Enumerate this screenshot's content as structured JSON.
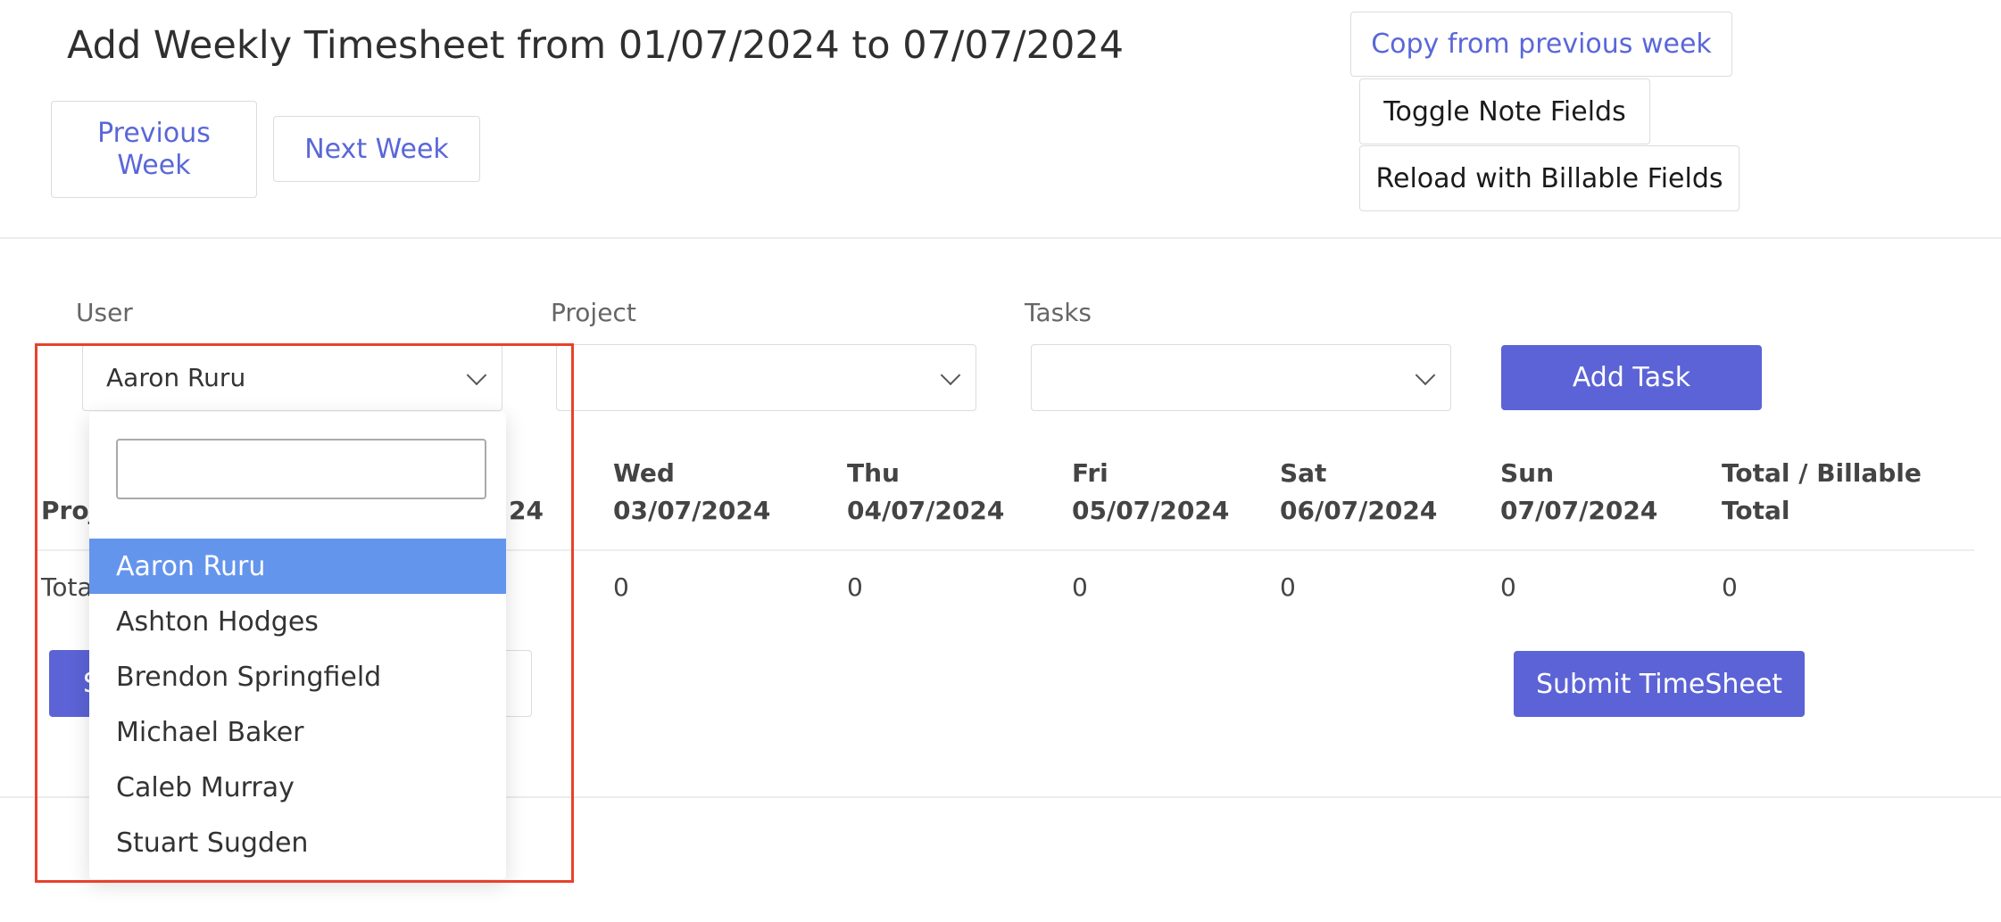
{
  "header": {
    "title": "Add Weekly Timesheet from 01/07/2024 to 07/07/2024",
    "previous_week": "Previous Week",
    "next_week": "Next Week",
    "copy_previous": "Copy from previous week",
    "toggle_notes": "Toggle Note Fields",
    "reload_billable": "Reload with Billable Fields"
  },
  "filters": {
    "user_label": "User",
    "user_value": "Aaron Ruru",
    "project_label": "Project",
    "project_value": "",
    "tasks_label": "Tasks",
    "tasks_value": "",
    "add_task": "Add Task"
  },
  "table": {
    "project_header_partial": "Proj",
    "tue_date_partial": "24",
    "columns": [
      {
        "day": "Wed",
        "date": "03/07/2024"
      },
      {
        "day": "Thu",
        "date": "04/07/2024"
      },
      {
        "day": "Fri",
        "date": "05/07/2024"
      },
      {
        "day": "Sat",
        "date": "06/07/2024"
      },
      {
        "day": "Sun",
        "date": "07/07/2024"
      },
      {
        "day": "Total / Billable",
        "date": "Total"
      }
    ],
    "total_label_partial": "Tota",
    "totals": [
      "0",
      "0",
      "0",
      "0",
      "0",
      "0"
    ]
  },
  "actions": {
    "submit_timesheet": "Submit TimeSheet",
    "save_partial": "S"
  },
  "user_dropdown": {
    "search_value": "",
    "options": [
      "Aaron Ruru",
      "Ashton Hodges",
      "Brendon Springfield",
      "Michael Baker",
      "Caleb Murray",
      "Stuart Sugden"
    ],
    "selected": "Aaron Ruru"
  },
  "colors": {
    "primary": "#5b63d6",
    "link": "#5a67d8",
    "selected_option": "#6495ed",
    "highlight_border": "#e8412c"
  }
}
